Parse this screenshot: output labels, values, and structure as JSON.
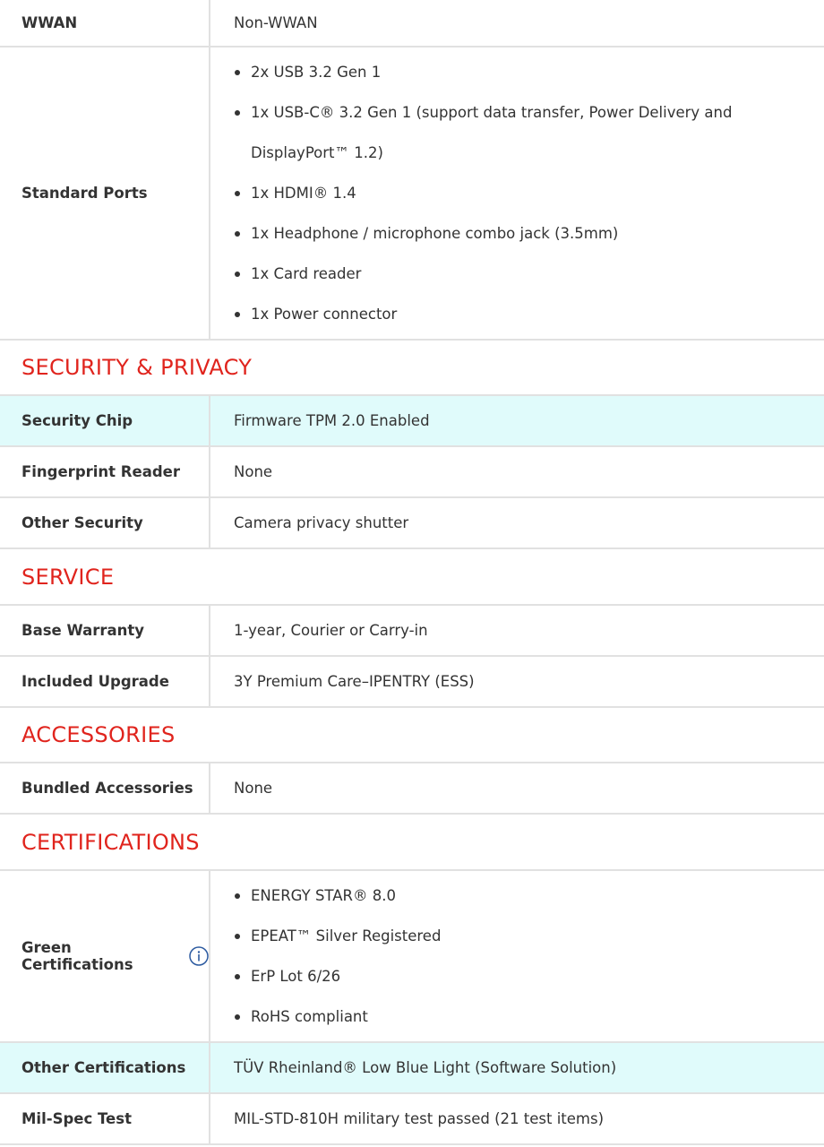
{
  "wwan": {
    "label": "WWAN",
    "value": "Non-WWAN"
  },
  "ports": {
    "label": "Standard Ports",
    "items": [
      "2x USB 3.2 Gen 1",
      "1x USB-C® 3.2 Gen 1 (support data transfer, Power Delivery and",
      "DisplayPort™ 1.2)",
      "1x HDMI® 1.4",
      "1x Headphone / microphone combo jack (3.5mm)",
      "1x Card reader",
      "1x Power connector"
    ]
  },
  "sections": {
    "security": "SECURITY & PRIVACY",
    "service": "SERVICE",
    "accessories": "ACCESSORIES",
    "certifications": "CERTIFICATIONS"
  },
  "security": [
    {
      "label": "Security Chip",
      "value": "Firmware TPM 2.0 Enabled"
    },
    {
      "label": "Fingerprint Reader",
      "value": "None"
    },
    {
      "label": "Other Security",
      "value": "Camera privacy shutter"
    }
  ],
  "service": [
    {
      "label": "Base Warranty",
      "value": "1-year, Courier or Carry-in"
    },
    {
      "label": "Included Upgrade",
      "value": "3Y Premium Care–IPENTRY (ESS)"
    }
  ],
  "accessories": [
    {
      "label": "Bundled Accessories",
      "value": "None"
    }
  ],
  "certifications": {
    "green": {
      "label": "Green Certifications",
      "icon": "info-icon",
      "items": [
        "ENERGY STAR® 8.0",
        "EPEAT™ Silver Registered",
        "ErP Lot 6/26",
        "RoHS compliant"
      ]
    },
    "other": {
      "label": "Other Certifications",
      "value": "TÜV Rheinland® Low Blue Light (Software Solution)"
    },
    "milspec": {
      "label": "Mil-Spec Test",
      "value": "MIL-STD-810H military test passed (21 test items)"
    }
  },
  "colors": {
    "section_heading": "#e0241d",
    "highlight_row": "#e0fbfb",
    "border": "#e1e1e1"
  }
}
